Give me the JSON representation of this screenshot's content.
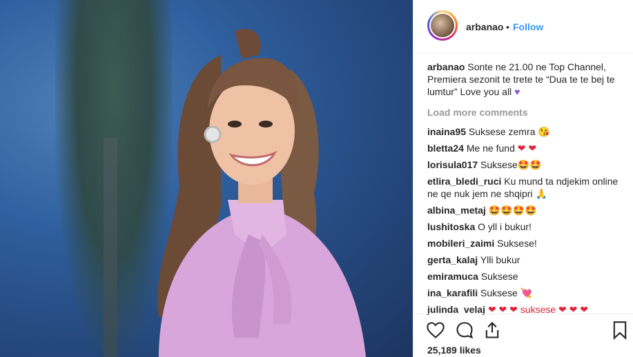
{
  "post": {
    "username": "arbanao",
    "dot": "•",
    "follow_label": "Follow",
    "caption_user": "arbanao",
    "caption_text": "Sonte ne 21.00 ne Top Channel, Premiera sezonit te trete te “Dua te te bej te lumtur” Love you all",
    "caption_emoji": "purple-heart",
    "load_more_label": "Load more comments",
    "likes": "25,189 likes"
  },
  "comments": [
    {
      "user": "inaina95",
      "text": "Suksese zemra",
      "emoji": "😘"
    },
    {
      "user": "bletta24",
      "text": "Me ne fund",
      "emoji": "❤ ❤"
    },
    {
      "user": "lorisula017",
      "text": "Suksese",
      "emoji": "🤩🤩"
    },
    {
      "user": "etlira_bledi_ruci",
      "text": "Ku mund ta ndjekim online ne qe nuk jem ne shqipri",
      "emoji": "🙏"
    },
    {
      "user": "albina_metaj",
      "text": "",
      "emoji": "🤩🤩🤩🤩"
    },
    {
      "user": "lushitoska",
      "text": "O yll i bukur!",
      "emoji": ""
    },
    {
      "user": "mobileri_zaimi",
      "text": "Suksese!",
      "emoji": ""
    },
    {
      "user": "gerta_kalaj",
      "text": "Ylli bukur",
      "emoji": ""
    },
    {
      "user": "emiramuca",
      "text": "Suksese",
      "emoji": ""
    },
    {
      "user": "ina_karafili",
      "text": "Suksese",
      "emoji": "💘"
    },
    {
      "user": "julinda_velaj",
      "text": "❤ ❤ ❤ suksese",
      "emoji": "❤ ❤ ❤"
    }
  ],
  "icons": {
    "like": "heart-outline-icon",
    "comment": "speech-bubble-icon",
    "share": "share-icon",
    "save": "bookmark-icon"
  },
  "colors": {
    "follow": "#3897f0",
    "text": "#262626",
    "muted": "#999999",
    "heart": "#e0243a"
  }
}
